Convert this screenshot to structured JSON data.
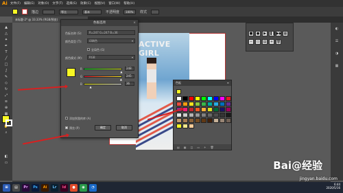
{
  "menubar": {
    "logo": "Ai",
    "items": [
      "文件(F)",
      "编辑(E)",
      "对象(O)",
      "文字(T)",
      "选择(S)",
      "效果(C)",
      "视图(V)",
      "窗口(W)",
      "帮助(H)"
    ]
  },
  "controlbar": {
    "stroke_label": "描边",
    "stroke_value": "",
    "profile_label": "等比",
    "style_label": "基本",
    "opacity_label": "不透明度",
    "opacity_value": "100%",
    "style2_label": "样式"
  },
  "doc_tab": {
    "label": "未标题-2* @ 33.33% (RGB/预览)"
  },
  "poster": {
    "title": "ACTIVE GIRL"
  },
  "dialog": {
    "title": "色板选项",
    "swatch_name_label": "色板名称 (S):",
    "swatch_name_value": "R=247 G=247 B=36",
    "color_type_label": "颜色类型 (T):",
    "color_type_value": "印刷色",
    "global_label": "全局色 (G)",
    "color_mode_label": "颜色模式 (M):",
    "color_mode_value": "RGB",
    "channels": [
      {
        "name": "R",
        "value": "248",
        "fraction": 0.97
      },
      {
        "name": "G",
        "value": "245",
        "fraction": 0.96
      },
      {
        "name": "B",
        "value": "36",
        "fraction": 0.14
      }
    ],
    "add_spot_label": "添加到我的库 (A)",
    "preview_label": "预览 (P)",
    "ok_label": "确定",
    "cancel_label": "取消",
    "swatch_color": "#f7f724"
  },
  "swatches_panel": {
    "title": "色板"
  },
  "watermark": {
    "brand": "Bai@经验",
    "url": "jingyan.baidu.com"
  },
  "taskbar": {
    "apps": [
      "Pr",
      "Ps",
      "Ai",
      "Lr",
      "Id"
    ],
    "time": "6:44",
    "date": "2020/5/16"
  },
  "colors": {
    "fill": "#f7f724",
    "accent_red": "#d82020",
    "panel_bg": "#535353"
  }
}
